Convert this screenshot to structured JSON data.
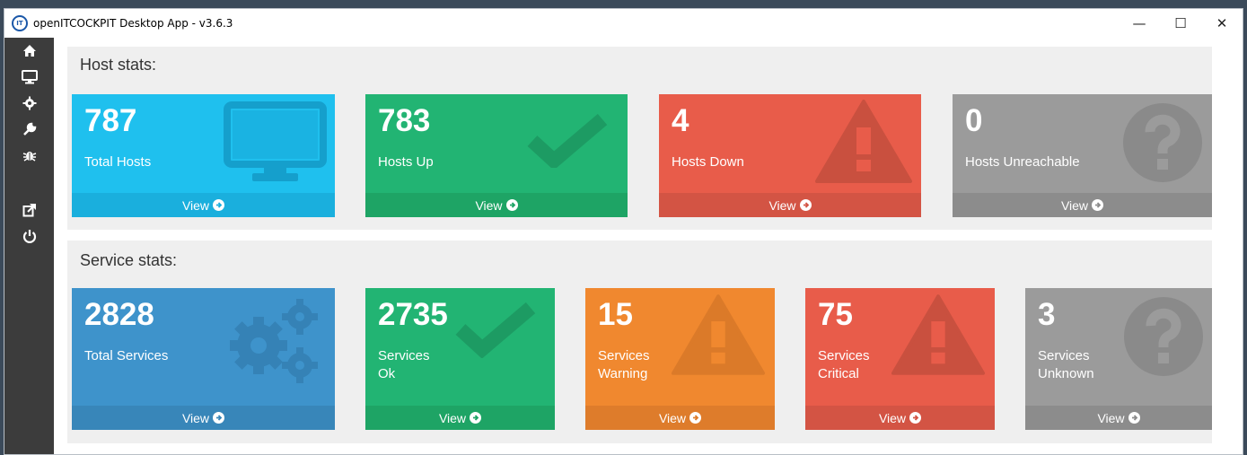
{
  "window": {
    "title": "openITCOCKPIT Desktop App - v3.6.3",
    "app_icon_text": "IT",
    "minimize": "—",
    "maximize": "☐",
    "close": "✕"
  },
  "sidebar": {
    "items": [
      {
        "icon": "home-icon"
      },
      {
        "icon": "desktop-icon"
      },
      {
        "icon": "gear-icon"
      },
      {
        "icon": "wrench-icon"
      },
      {
        "icon": "bug-icon"
      },
      {
        "icon": "external-link-icon"
      },
      {
        "icon": "power-icon"
      }
    ]
  },
  "host_stats": {
    "title": "Host stats:",
    "view_label": "View",
    "boxes": [
      {
        "value": "787",
        "label": "Total Hosts",
        "color": "#1fc0ee",
        "foot_color": "#1aafdd",
        "icon": "monitor-icon"
      },
      {
        "value": "783",
        "label": "Hosts Up",
        "color": "#22b473",
        "foot_color": "#1ea465",
        "icon": "check-icon"
      },
      {
        "value": "4",
        "label": "Hosts Down",
        "color": "#e85c4a",
        "foot_color": "#d35444",
        "icon": "warning-icon"
      },
      {
        "value": "0",
        "label": "Hosts Unreachable",
        "color": "#9b9b9b",
        "foot_color": "#8c8c8c",
        "icon": "question-icon"
      }
    ]
  },
  "service_stats": {
    "title": "Service stats:",
    "view_label": "View",
    "boxes": [
      {
        "value": "2828",
        "label": "Total Services",
        "label2": "",
        "color": "#3e93cb",
        "foot_color": "#3886b9",
        "icon": "gears-icon"
      },
      {
        "value": "2735",
        "label": "Services",
        "label2": "Ok",
        "color": "#22b473",
        "foot_color": "#1ea465",
        "icon": "check-icon"
      },
      {
        "value": "15",
        "label": "Services",
        "label2": "Warning",
        "color": "#f0882f",
        "foot_color": "#de7c2b",
        "icon": "warning-icon"
      },
      {
        "value": "75",
        "label": "Services",
        "label2": "Critical",
        "color": "#e85c4a",
        "foot_color": "#d35444",
        "icon": "warning-icon"
      },
      {
        "value": "3",
        "label": "Services",
        "label2": "Unknown",
        "color": "#9b9b9b",
        "foot_color": "#8c8c8c",
        "icon": "question-icon"
      }
    ]
  }
}
